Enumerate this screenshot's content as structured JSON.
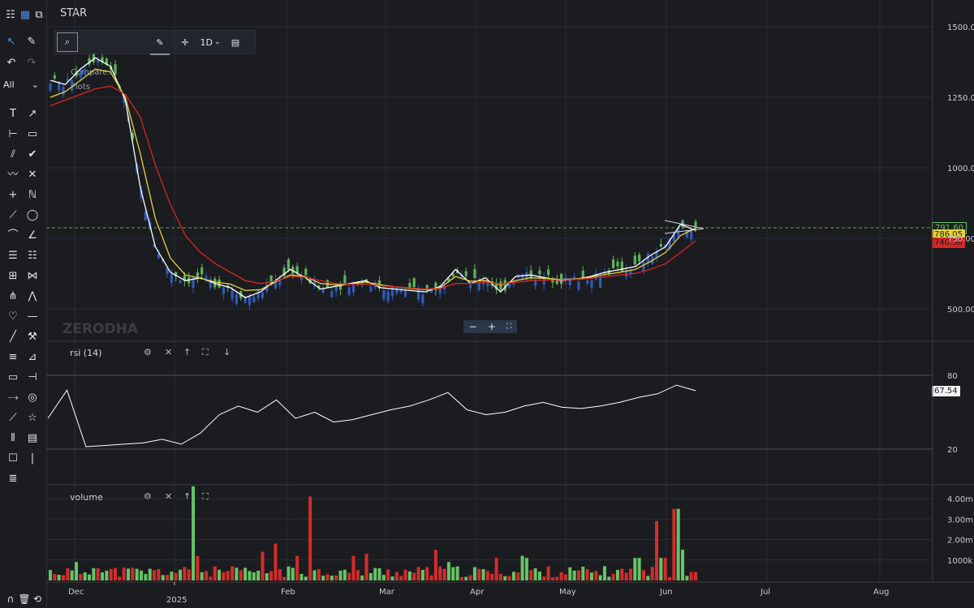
{
  "symbol": "STAR",
  "toolbar": {
    "filter_label": "All",
    "tools": [
      "text-tool",
      "arrow-tool",
      "horizontal-ray-tool",
      "callout-tool",
      "parallel-channel-tool",
      "check-tool",
      "wave-tool",
      "cross-tool",
      "crosshair-tool",
      "signature-tool",
      "trend-line-tool",
      "ellipse-tool",
      "arc-tool",
      "angle-tool",
      "fib-retracement-tool",
      "fib-extension-tool",
      "gann-tool",
      "bowtie-tool",
      "pitchfork-tool",
      "zigzag-tool",
      "heart-tool",
      "horizontal-line-tool",
      "line-tool",
      "measure-tool",
      "levels-tool",
      "ruler-tool",
      "rectangle-tool",
      "range-tool",
      "projection-tool",
      "eye-tool",
      "brush-tool",
      "star-tool",
      "bars-tool",
      "grid-tool",
      "note-tool",
      "vertical-line-tool",
      "align-tool"
    ]
  },
  "controls": {
    "interval": "1D",
    "compare_label": "Compare...",
    "plots_label": "Plots"
  },
  "watermark": "ZERODHA",
  "price_panel": {
    "yticks": [
      "1500.00",
      "1250.00",
      "1000.00",
      "750.00",
      "500.00"
    ],
    "last_price": "791.60",
    "ma_yellow": "786.05",
    "ma_red": "740.58"
  },
  "rsi_panel": {
    "label": "rsi (14)",
    "yticks": [
      "80",
      "20"
    ],
    "last": "67.54"
  },
  "volume_panel": {
    "label": "volume",
    "yticks": [
      "4.00m",
      "3.00m",
      "2.00m",
      "1000k"
    ]
  },
  "xaxis": {
    "labels": [
      "Dec",
      "2025",
      "Feb",
      "Mar",
      "Apr",
      "May",
      "Jun",
      "Jul",
      "Aug"
    ]
  },
  "colors": {
    "up": "#66c466",
    "up_candle": "#5fb35f",
    "down_candle": "#2f5bb8",
    "down_vol": "#d42c2c",
    "ma_white": "#ffffff",
    "ma_yellow": "#e6d23a",
    "ma_red": "#d82525",
    "grid": "#2c3b4c",
    "background": "#1b1c1f"
  },
  "chart_data": {
    "type": "line",
    "title": "STAR",
    "x_labels": [
      "Dec",
      "2025",
      "Feb",
      "Mar",
      "Apr",
      "May",
      "Jun",
      "Jul",
      "Aug"
    ],
    "ylim": [
      420,
      1560
    ],
    "series": [
      {
        "values": [
          1310,
          1295,
          1350,
          1390,
          1360,
          1240,
          930,
          720,
          630,
          600,
          610,
          590,
          575,
          540,
          560,
          600,
          640,
          610,
          570,
          580,
          590,
          600,
          575,
          570,
          565,
          560,
          580,
          640,
          590,
          610,
          560,
          615,
          620,
          610,
          600,
          605,
          615,
          630,
          640,
          650,
          690,
          720,
          800,
          778
        ]
      },
      {
        "values": [
          1250,
          1270,
          1310,
          1350,
          1340,
          1250,
          1050,
          820,
          680,
          620,
          608,
          595,
          588,
          565,
          568,
          595,
          620,
          615,
          590,
          585,
          588,
          595,
          585,
          578,
          572,
          568,
          575,
          615,
          598,
          600,
          585,
          600,
          610,
          608,
          604,
          606,
          612,
          622,
          630,
          640,
          668,
          700,
          760,
          786
        ]
      },
      {
        "values": [
          1220,
          1240,
          1260,
          1280,
          1290,
          1260,
          1180,
          1010,
          870,
          760,
          700,
          660,
          630,
          600,
          590,
          598,
          615,
          612,
          600,
          590,
          587,
          588,
          582,
          578,
          574,
          570,
          572,
          590,
          590,
          594,
          588,
          594,
          600,
          602,
          602,
          604,
          608,
          614,
          620,
          626,
          640,
          660,
          700,
          741
        ]
      }
    ],
    "volume": {
      "ylim": [
        0,
        4500000
      ]
    },
    "rsi": {
      "values": [
        45,
        68,
        22,
        23,
        24,
        25,
        28,
        24,
        33,
        48,
        55,
        50,
        60,
        45,
        50,
        42,
        44,
        48,
        52,
        55,
        60,
        66,
        52,
        48,
        50,
        55,
        58,
        54,
        53,
        55,
        58,
        62,
        65,
        72,
        67.54
      ],
      "levels": [
        80,
        20
      ]
    }
  }
}
